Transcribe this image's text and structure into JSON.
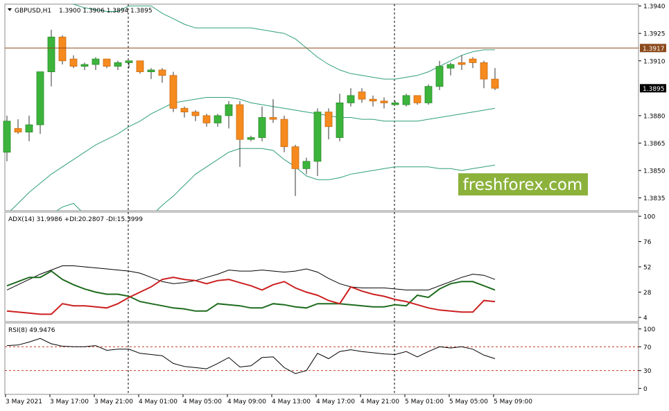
{
  "chart_data": [
    {
      "type": "candlestick",
      "title": "GBPUSD,H1",
      "ohlc_header": "1.3900 1.3906 1.3894 1.3895",
      "ylim": [
        1.3828,
        1.3941
      ],
      "y_ticks": [
        "1.3940",
        "1.3925",
        "1.3910",
        "1.3895",
        "1.3880",
        "1.3865",
        "1.3850",
        "1.3835"
      ],
      "price_lines": [
        {
          "label": "1.3917",
          "value": 1.3917,
          "color": "#8b4a1c"
        },
        {
          "label": "1.3895",
          "value": 1.3895,
          "color": "#000000"
        }
      ],
      "candles": [
        {
          "o": 1.386,
          "h": 1.388,
          "l": 1.3855,
          "c": 1.3877
        },
        {
          "o": 1.3873,
          "h": 1.3878,
          "l": 1.387,
          "c": 1.3871
        },
        {
          "o": 1.3871,
          "h": 1.388,
          "l": 1.3866,
          "c": 1.3875
        },
        {
          "o": 1.3875,
          "h": 1.3895,
          "l": 1.387,
          "c": 1.3904
        },
        {
          "o": 1.3904,
          "h": 1.3927,
          "l": 1.3896,
          "c": 1.3923
        },
        {
          "o": 1.3923,
          "h": 1.3924,
          "l": 1.3908,
          "c": 1.391
        },
        {
          "o": 1.3911,
          "h": 1.3913,
          "l": 1.3906,
          "c": 1.3907
        },
        {
          "o": 1.3907,
          "h": 1.3909,
          "l": 1.3905,
          "c": 1.3908
        },
        {
          "o": 1.3908,
          "h": 1.3912,
          "l": 1.3905,
          "c": 1.3911
        },
        {
          "o": 1.3911,
          "h": 1.3911,
          "l": 1.3906,
          "c": 1.3907
        },
        {
          "o": 1.3907,
          "h": 1.391,
          "l": 1.3905,
          "c": 1.3909
        },
        {
          "o": 1.3909,
          "h": 1.391,
          "l": 1.3906,
          "c": 1.391
        },
        {
          "o": 1.391,
          "h": 1.391,
          "l": 1.3903,
          "c": 1.3904
        },
        {
          "o": 1.3904,
          "h": 1.3906,
          "l": 1.39,
          "c": 1.3905
        },
        {
          "o": 1.3905,
          "h": 1.3906,
          "l": 1.3898,
          "c": 1.3902
        },
        {
          "o": 1.3902,
          "h": 1.3904,
          "l": 1.3882,
          "c": 1.3884
        },
        {
          "o": 1.3884,
          "h": 1.3885,
          "l": 1.3879,
          "c": 1.3882
        },
        {
          "o": 1.3882,
          "h": 1.3883,
          "l": 1.3877,
          "c": 1.388
        },
        {
          "o": 1.388,
          "h": 1.3881,
          "l": 1.3874,
          "c": 1.3876
        },
        {
          "o": 1.3876,
          "h": 1.3881,
          "l": 1.3874,
          "c": 1.388
        },
        {
          "o": 1.388,
          "h": 1.3888,
          "l": 1.3873,
          "c": 1.3886
        },
        {
          "o": 1.3886,
          "h": 1.3888,
          "l": 1.3852,
          "c": 1.3867
        },
        {
          "o": 1.3867,
          "h": 1.3869,
          "l": 1.3866,
          "c": 1.3868
        },
        {
          "o": 1.3868,
          "h": 1.3885,
          "l": 1.3866,
          "c": 1.3879
        },
        {
          "o": 1.3879,
          "h": 1.3889,
          "l": 1.3876,
          "c": 1.3878
        },
        {
          "o": 1.3878,
          "h": 1.388,
          "l": 1.386,
          "c": 1.3863
        },
        {
          "o": 1.3863,
          "h": 1.3864,
          "l": 1.3836,
          "c": 1.3851
        },
        {
          "o": 1.3851,
          "h": 1.3857,
          "l": 1.3848,
          "c": 1.3855
        },
        {
          "o": 1.3855,
          "h": 1.3884,
          "l": 1.3847,
          "c": 1.3882
        },
        {
          "o": 1.3882,
          "h": 1.3884,
          "l": 1.3867,
          "c": 1.3874
        },
        {
          "o": 1.3868,
          "h": 1.3892,
          "l": 1.3866,
          "c": 1.3887
        },
        {
          "o": 1.3887,
          "h": 1.3895,
          "l": 1.3885,
          "c": 1.3891
        },
        {
          "o": 1.3893,
          "h": 1.3895,
          "l": 1.3887,
          "c": 1.3889
        },
        {
          "o": 1.3889,
          "h": 1.3891,
          "l": 1.3885,
          "c": 1.3888
        },
        {
          "o": 1.3888,
          "h": 1.389,
          "l": 1.3884,
          "c": 1.3887
        },
        {
          "o": 1.3886,
          "h": 1.3888,
          "l": 1.3886,
          "c": 1.3887
        },
        {
          "o": 1.3886,
          "h": 1.3892,
          "l": 1.3885,
          "c": 1.3891
        },
        {
          "o": 1.3891,
          "h": 1.3891,
          "l": 1.3886,
          "c": 1.3887
        },
        {
          "o": 1.3887,
          "h": 1.3897,
          "l": 1.3886,
          "c": 1.3896
        },
        {
          "o": 1.3896,
          "h": 1.391,
          "l": 1.3894,
          "c": 1.3907
        },
        {
          "o": 1.3906,
          "h": 1.3909,
          "l": 1.3902,
          "c": 1.3908
        },
        {
          "o": 1.3909,
          "h": 1.3913,
          "l": 1.3905,
          "c": 1.3908
        },
        {
          "o": 1.3911,
          "h": 1.3912,
          "l": 1.3906,
          "c": 1.3909
        },
        {
          "o": 1.3909,
          "h": 1.391,
          "l": 1.3895,
          "c": 1.39
        },
        {
          "o": 1.39,
          "h": 1.3906,
          "l": 1.3894,
          "c": 1.3895
        }
      ],
      "bollinger": {
        "upper": [
          1.3951,
          1.395,
          1.3948,
          1.3946,
          1.3944,
          1.3943,
          1.3941,
          1.3939,
          1.3938,
          1.3937,
          1.3937,
          1.394,
          1.394,
          1.394,
          1.3936,
          1.3933,
          1.393,
          1.3928,
          1.3928,
          1.3928,
          1.3928,
          1.3928,
          1.3928,
          1.3927,
          1.3926,
          1.3925,
          1.3922,
          1.3917,
          1.3912,
          1.3908,
          1.3905,
          1.3903,
          1.3902,
          1.3901,
          1.39,
          1.39,
          1.3901,
          1.3902,
          1.3904,
          1.3907,
          1.391,
          1.3913,
          1.3915,
          1.3916,
          1.3916
        ],
        "middle": [
          1.3826,
          1.3832,
          1.3838,
          1.3843,
          1.3848,
          1.3852,
          1.3856,
          1.386,
          1.3864,
          1.3867,
          1.387,
          1.3874,
          1.3877,
          1.3881,
          1.3884,
          1.3887,
          1.3888,
          1.3889,
          1.389,
          1.389,
          1.389,
          1.3889,
          1.3887,
          1.3886,
          1.3885,
          1.3884,
          1.3883,
          1.3882,
          1.3881,
          1.388,
          1.3879,
          1.3879,
          1.3878,
          1.3878,
          1.3877,
          1.3877,
          1.3877,
          1.3877,
          1.3878,
          1.3879,
          1.388,
          1.3881,
          1.3882,
          1.3883,
          1.3884
        ],
        "lower": [
          1.3808,
          1.3812,
          1.3816,
          1.382,
          1.3826,
          1.383,
          1.3832,
          1.3826,
          1.382,
          1.3817,
          1.3815,
          1.3816,
          1.3819,
          1.3825,
          1.3831,
          1.3836,
          1.3842,
          1.3848,
          1.3852,
          1.3856,
          1.386,
          1.3862,
          1.3862,
          1.3862,
          1.3861,
          1.3856,
          1.3852,
          1.3847,
          1.3845,
          1.3845,
          1.3846,
          1.3848,
          1.3849,
          1.385,
          1.3851,
          1.3852,
          1.3852,
          1.3852,
          1.3852,
          1.3851,
          1.3851,
          1.385,
          1.3851,
          1.3852,
          1.3853
        ]
      },
      "watermark": "freshforex.com"
    },
    {
      "type": "line",
      "title": "ADX(14) 31.9986 +DI:20.2807 -DI:15.3999",
      "ylim": [
        0,
        104
      ],
      "y_ticks": [
        "100",
        "76",
        "52",
        "28",
        "4"
      ],
      "series": [
        {
          "name": "ADX",
          "color": "#000000",
          "values": [
            30,
            35,
            40,
            45,
            49,
            53,
            53,
            52,
            51,
            50,
            49,
            48,
            46,
            42,
            38,
            36,
            37,
            39,
            42,
            45,
            49,
            48,
            48,
            49,
            48,
            47,
            48,
            50,
            47,
            41,
            36,
            33,
            32,
            32,
            32,
            31,
            30,
            30,
            30,
            34,
            38,
            42,
            45,
            44,
            40
          ]
        },
        {
          "name": "+DI",
          "color": "#1e6b1e",
          "values": [
            34,
            38,
            42,
            42,
            48,
            40,
            35,
            31,
            28,
            26,
            26,
            24,
            19,
            17,
            15,
            13,
            12,
            10,
            10,
            17,
            16,
            15,
            13,
            13,
            17,
            16,
            14,
            13,
            17,
            17,
            17,
            16,
            15,
            14,
            14,
            16,
            15,
            25,
            23,
            31,
            36,
            38,
            38,
            34,
            30
          ]
        },
        {
          "name": "-DI",
          "color": "#cc1f1f",
          "values": [
            10,
            9,
            8,
            7,
            7,
            17,
            15,
            15,
            14,
            13,
            17,
            23,
            28,
            33,
            40,
            42,
            40,
            39,
            36,
            39,
            40,
            37,
            34,
            30,
            35,
            38,
            32,
            28,
            25,
            20,
            17,
            33,
            29,
            26,
            24,
            21,
            19,
            16,
            13,
            11,
            10,
            9,
            9,
            20,
            19
          ]
        }
      ]
    },
    {
      "type": "line",
      "title": "RSI(8) 49.9476",
      "ylim": [
        -10,
        110
      ],
      "y_ticks": [
        "100",
        "70",
        "30",
        "0"
      ],
      "levels": [
        70,
        30
      ],
      "series": [
        {
          "name": "RSI",
          "color": "#000000",
          "values": [
            72,
            73,
            78,
            84,
            75,
            71,
            70,
            70,
            72,
            64,
            66,
            66,
            59,
            57,
            55,
            42,
            37,
            35,
            33,
            42,
            52,
            36,
            38,
            52,
            53,
            35,
            25,
            30,
            59,
            50,
            62,
            65,
            62,
            60,
            58,
            57,
            62,
            53,
            62,
            70,
            68,
            70,
            66,
            56,
            50
          ]
        }
      ]
    }
  ],
  "x_axis_labels": [
    "3 May 2021",
    "3 May 17:00",
    "3 May 21:00",
    "4 May 01:00",
    "4 May 05:00",
    "4 May 09:00",
    "4 May 13:00",
    "4 May 17:00",
    "4 May 21:00",
    "5 May 01:00",
    "5 May 05:00",
    "5 May 09:00"
  ]
}
